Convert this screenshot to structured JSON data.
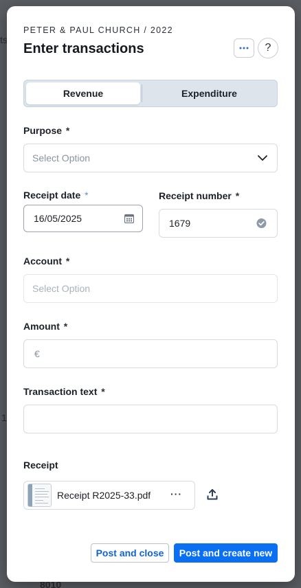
{
  "background": {
    "fragments": [
      "ts",
      "1",
      "8010"
    ]
  },
  "header": {
    "org_line": "PETER & PAUL CHURCH / 2022",
    "title": "Enter transactions",
    "more_icon": "ellipsis-icon",
    "help_label": "?"
  },
  "tabs": [
    {
      "label": "Revenue",
      "active": true
    },
    {
      "label": "Expenditure",
      "active": false
    }
  ],
  "form": {
    "purpose": {
      "label": "Purpose",
      "required": "*",
      "placeholder": "Select Option"
    },
    "receipt_date": {
      "label": "Receipt date",
      "required": "*",
      "value": "16/05/2025"
    },
    "receipt_number": {
      "label": "Receipt number",
      "required": "*",
      "value": "1679"
    },
    "account": {
      "label": "Account",
      "required": "*",
      "placeholder": "Select Option"
    },
    "amount": {
      "label": "Amount",
      "required": "*",
      "currency": "€",
      "value": ""
    },
    "transaction_text": {
      "label": "Transaction text",
      "required": "*",
      "value": ""
    },
    "receipt": {
      "label": "Receipt",
      "file_name": "Receipt R2025-33.pdf",
      "more_label": "···"
    }
  },
  "footer": {
    "secondary_label": "Post and close",
    "primary_label": "Post and create new"
  },
  "colors": {
    "primary": "#0a6ff0",
    "accent_text": "#1263c9",
    "tab_bg": "#dde4ec"
  }
}
